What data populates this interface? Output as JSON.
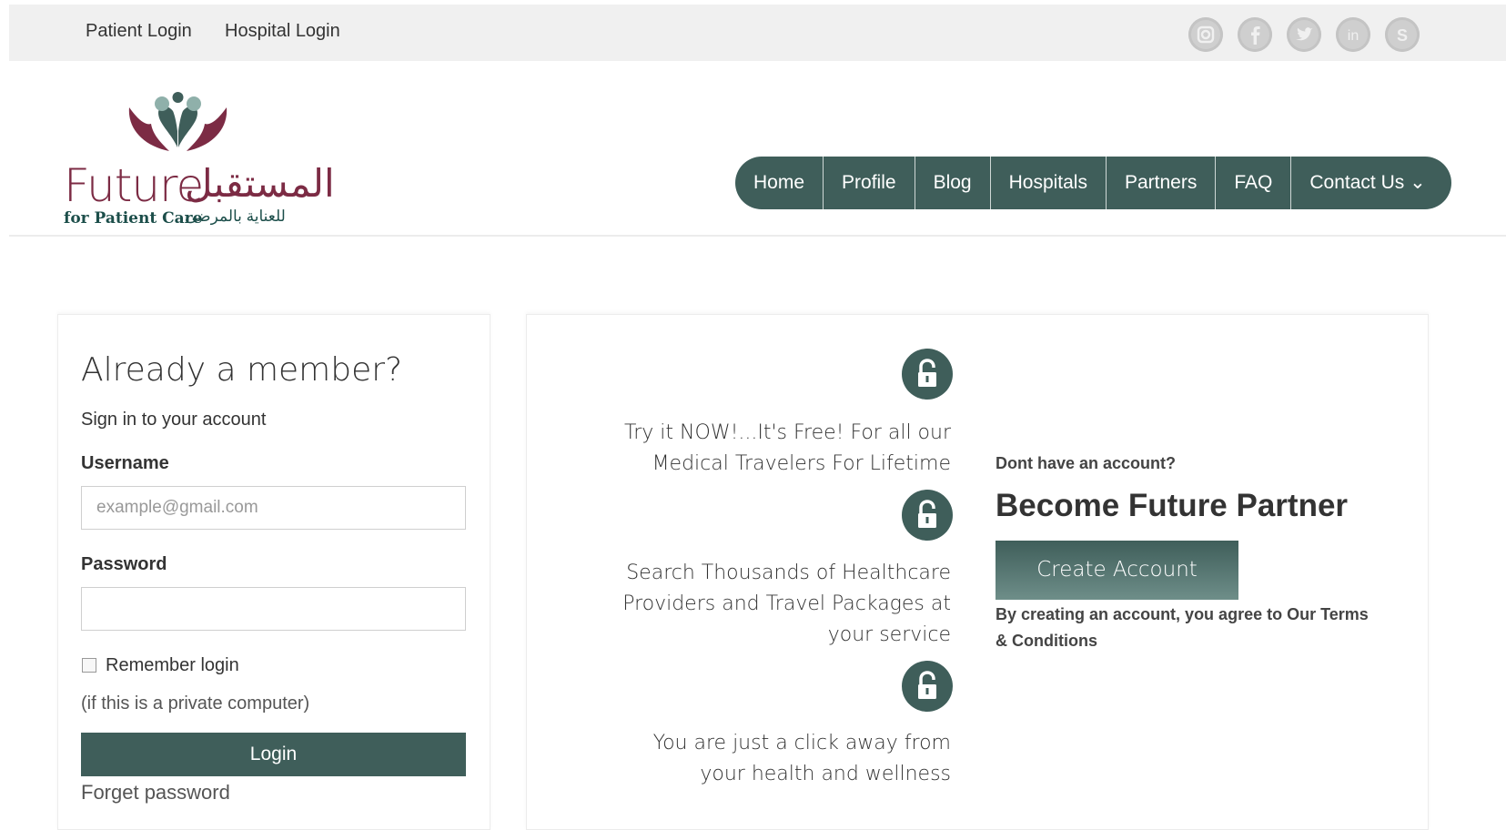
{
  "topbar": {
    "patient_login": "Patient Login",
    "hospital_login": "Hospital Login",
    "social": [
      "instagram-icon",
      "facebook-icon",
      "twitter-icon",
      "linkedin-icon",
      "skype-icon"
    ]
  },
  "logo": {
    "name_en": "Future",
    "name_ar": "المستقبل",
    "tagline_en": "for Patient Care",
    "tagline_ar": "للعناية بالمرضى"
  },
  "nav": {
    "items": [
      "Home",
      "Profile",
      "Blog",
      "Hospitals",
      "Partners",
      "FAQ",
      "Contact Us ⌄"
    ]
  },
  "login": {
    "title": "Already a member?",
    "subtitle": "Sign in to your account",
    "username_label": "Username",
    "username_placeholder": "example@gmail.com",
    "password_label": "Password",
    "remember_label": "Remember login",
    "remember_checked": false,
    "private_note": "(if this is a private computer)",
    "login_button": "Login",
    "forget_link": "Forget password"
  },
  "features": [
    {
      "line1": "Try it NOW!...It's Free! For all our",
      "line2": "Medical Travelers For Lifetime",
      "line3": ""
    },
    {
      "line1": "Search Thousands of Healthcare",
      "line2": "Providers and Travel Packages at",
      "line3": "your service"
    },
    {
      "line1": "You are just a click away from",
      "line2": "your health and wellness",
      "line3": ""
    }
  ],
  "partner": {
    "question": "Dont have an account?",
    "heading": "Become Future Partner",
    "create_button": "Create Account",
    "terms": "By creating an account, you agree to Our Terms & Conditions"
  },
  "colors": {
    "brand_teal": "#3f5e5a",
    "brand_maroon": "#7c2b44",
    "topbar_bg": "#f0f0f0"
  }
}
